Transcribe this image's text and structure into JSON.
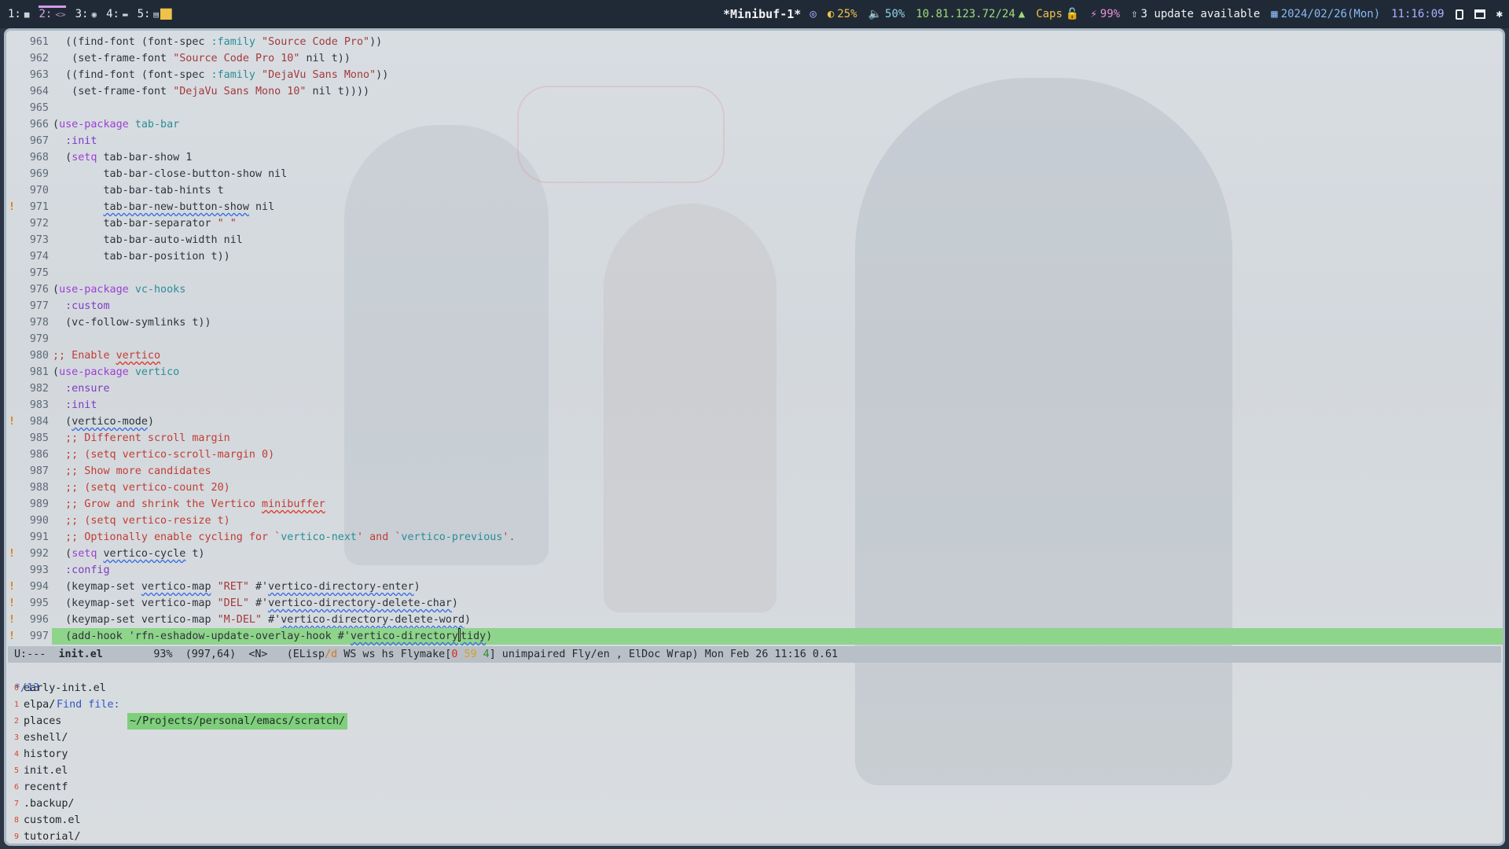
{
  "topbar": {
    "workspaces": [
      {
        "label": "1:",
        "icon": "terminal-icon",
        "glyph": "■"
      },
      {
        "label": "2:",
        "icon": "code-icon",
        "glyph": "<>",
        "active": true
      },
      {
        "label": "3:",
        "icon": "chrome-icon",
        "glyph": "◉"
      },
      {
        "label": "4:",
        "icon": "window-icon",
        "glyph": "▬"
      },
      {
        "label": "5:",
        "icon": "file-icon",
        "glyph": "▤"
      }
    ],
    "workspace_extra": "██",
    "window_title": "*Minibuf-1*",
    "status": {
      "brightness": "25%",
      "volume": "50%",
      "ip": "10.81.123.72/24",
      "caps": "Caps",
      "battery": "99%",
      "updates": "3 update available",
      "date": "2024/02/26(Mon)",
      "time": "11:16:09"
    }
  },
  "editor": {
    "current_line": "997",
    "lines": [
      {
        "n": "961",
        "html": "  ((find-font (font-spec <span class=\"ty\">:family</span> <span class=\"str\">\"Source Code Pro\"</span>))"
      },
      {
        "n": "962",
        "html": "   (set-frame-font <span class=\"str\">\"Source Code Pro 10\"</span> nil t))"
      },
      {
        "n": "963",
        "html": "  ((find-font (font-spec <span class=\"ty\">:family</span> <span class=\"str\">\"DejaVu Sans Mono\"</span>))"
      },
      {
        "n": "964",
        "html": "   (set-frame-font <span class=\"str\">\"DejaVu Sans Mono 10\"</span> nil t))))"
      },
      {
        "n": "965",
        "html": ""
      },
      {
        "n": "966",
        "html": "(<span class=\"kw\">use-package</span> <span class=\"ty\">tab-bar</span>"
      },
      {
        "n": "967",
        "html": "  <span class=\"kwd\">:init</span>"
      },
      {
        "n": "968",
        "html": "  (<span class=\"kw\">setq</span> tab-bar-show 1"
      },
      {
        "n": "969",
        "html": "        tab-bar-close-button-show nil"
      },
      {
        "n": "970",
        "html": "        tab-bar-tab-hints t"
      },
      {
        "n": "971",
        "warn": true,
        "html": "        <span class=\"wavy-blue\">tab-bar-new-button-show</span> nil"
      },
      {
        "n": "972",
        "html": "        tab-bar-separator <span class=\"str\">\" \"</span>"
      },
      {
        "n": "973",
        "html": "        tab-bar-auto-width nil"
      },
      {
        "n": "974",
        "html": "        tab-bar-position t))"
      },
      {
        "n": "975",
        "html": ""
      },
      {
        "n": "976",
        "html": "(<span class=\"kw\">use-package</span> <span class=\"ty\">vc-hooks</span>"
      },
      {
        "n": "977",
        "html": "  <span class=\"kwd\">:custom</span>"
      },
      {
        "n": "978",
        "html": "  (vc-follow-symlinks t))"
      },
      {
        "n": "979",
        "html": ""
      },
      {
        "n": "980",
        "html": "<span class=\"cmt\">;; Enable <span class=\"wavy-red\">vertico</span></span>"
      },
      {
        "n": "981",
        "html": "(<span class=\"kw\">use-package</span> <span class=\"ty\">vertico</span>"
      },
      {
        "n": "982",
        "html": "  <span class=\"kwd\">:ensure</span>"
      },
      {
        "n": "983",
        "html": "  <span class=\"kwd\">:init</span>"
      },
      {
        "n": "984",
        "warn": true,
        "html": "  (<span class=\"wavy-blue\">vertico-mode</span>)"
      },
      {
        "n": "985",
        "html": "  <span class=\"cmt\">;; Different scroll margin</span>"
      },
      {
        "n": "986",
        "html": "  <span class=\"cmt\">;; (setq vertico-scroll-margin 0)</span>"
      },
      {
        "n": "987",
        "html": "  <span class=\"cmt\">;; Show more candidates</span>"
      },
      {
        "n": "988",
        "html": "  <span class=\"cmt\">;; (setq vertico-count 20)</span>"
      },
      {
        "n": "989",
        "html": "  <span class=\"cmt\">;; Grow and shrink the Vertico <span class=\"wavy-red\">minibuffer</span></span>"
      },
      {
        "n": "990",
        "html": "  <span class=\"cmt\">;; (setq vertico-resize t)</span>"
      },
      {
        "n": "991",
        "html": "  <span class=\"cmt\">;; Optionally enable cycling for `<span class=\"cmt-ref\">vertico-next</span>' and `<span class=\"cmt-ref\">vertico-previous</span>'.</span>"
      },
      {
        "n": "992",
        "warn": true,
        "html": "  (<span class=\"kw\">setq</span> <span class=\"wavy-blue\">vertico-cycle</span> t)"
      },
      {
        "n": "993",
        "html": "  <span class=\"kwd\">:config</span>"
      },
      {
        "n": "994",
        "warn": true,
        "html": "  (keymap-set <span class=\"wavy-blue\">vertico-map</span> <span class=\"str\">\"RET\"</span> #'<span class=\"wavy-blue\">vertico-directory-enter</span>)"
      },
      {
        "n": "995",
        "warn": true,
        "html": "  (keymap-set vertico-map <span class=\"str\">\"DEL\"</span> #'<span class=\"wavy-blue\">vertico-directory-delete-char</span>)"
      },
      {
        "n": "996",
        "warn": true,
        "html": "  (keymap-set vertico-map <span class=\"str\">\"M-DEL\"</span> #'<span class=\"wavy-blue\">vertico-directory-delete-word</span>)"
      },
      {
        "n": "997",
        "warn": true,
        "current": true,
        "html": "  (add-hook 'rfn-eshadow-update-overlay-hook #'<span class=\"wavy-blue\">vertico-directory<span class=\"cursor\"></span>tidy</span>)"
      }
    ]
  },
  "modeline": {
    "state": "U:---",
    "buffer": "init.el",
    "percent": "93%",
    "position": "(997,64)",
    "evil": "<N>",
    "mode_prefix": "(ELisp",
    "mode_slash": "/d",
    "minors": "WS ws hs Flymake[",
    "fm_err": "0",
    "fm_warn": "59",
    "fm_note": "4",
    "minors_rest": "] unimpaired Fly/en , ElDoc Wrap)",
    "datetime": "Mon Feb 26 11:16",
    "load": "0.61"
  },
  "minibuffer": {
    "count": "*/13",
    "prompt": "Find file:",
    "path": "~/Projects/personal/emacs/scratch/",
    "candidates": [
      {
        "idx": "0",
        "name": "early-init.el"
      },
      {
        "idx": "1",
        "name": "elpa/"
      },
      {
        "idx": "2",
        "name": "places"
      },
      {
        "idx": "3",
        "name": "eshell/"
      },
      {
        "idx": "4",
        "name": "history"
      },
      {
        "idx": "5",
        "name": "init.el"
      },
      {
        "idx": "6",
        "name": "recentf"
      },
      {
        "idx": "7",
        "name": ".backup/"
      },
      {
        "idx": "8",
        "name": "custom.el"
      },
      {
        "idx": "9",
        "name": "tutorial/"
      }
    ]
  }
}
